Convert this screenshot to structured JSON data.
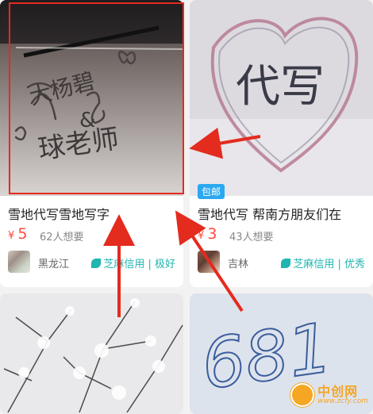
{
  "listings": [
    {
      "title": "雪地代写雪地写字",
      "currency": "¥",
      "price": "5",
      "want": "62人想要",
      "location": "黑龙江",
      "credit": "芝麻信用 | 极好",
      "snow_text_line1": "大杨碧",
      "snow_text_line2": "&",
      "snow_text_line3": "球老师"
    },
    {
      "title": "雪地代写 帮南方朋友们在",
      "currency": "¥",
      "price": "3",
      "want": "43人想要",
      "location": "吉林",
      "credit": "芝麻信用 | 优秀",
      "badge": "包邮",
      "snow_text": "代写"
    },
    {
      "image": "snowy-branches"
    },
    {
      "snow_text": "681"
    }
  ],
  "watermark": {
    "name": "中创网",
    "url": "www.zcfy.com"
  },
  "colors": {
    "price": "#ff4a3a",
    "credit": "#1fb5b0",
    "badge": "#2aa9f0",
    "highlight": "#e32b1e",
    "watermark": "#f5a623"
  }
}
